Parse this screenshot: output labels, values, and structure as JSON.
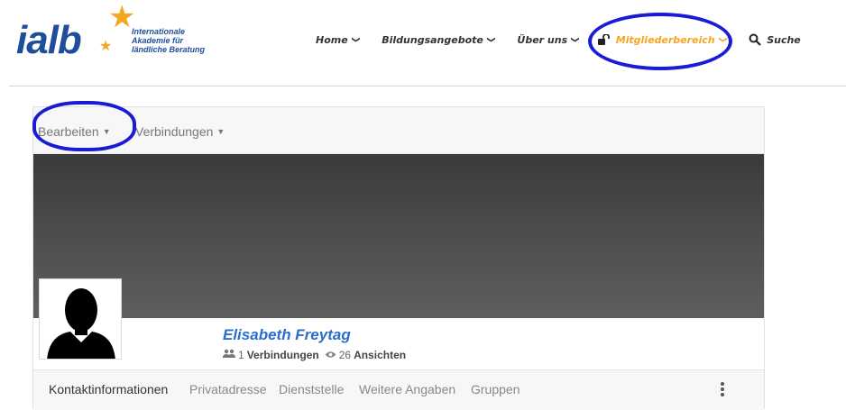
{
  "logo": {
    "word": "ialb",
    "text_lines": [
      "Internationale",
      "Akademie für",
      "ländliche Beratung"
    ]
  },
  "nav": {
    "items": [
      {
        "label": "Home",
        "has_dropdown": true
      },
      {
        "label": "Bildungsangebote",
        "has_dropdown": true
      },
      {
        "label": "Über uns",
        "has_dropdown": true
      },
      {
        "label": "Mitgliederbereich",
        "has_dropdown": true,
        "icon": "lock-open-icon",
        "color": "#f5a623"
      },
      {
        "label": "Suche",
        "icon": "search-icon"
      }
    ]
  },
  "toolbar": {
    "bearbeiten": "Bearbeiten",
    "verbindungen": "Verbindungen"
  },
  "profile": {
    "name": "Elisabeth Freytag",
    "connections_count": "1",
    "connections_label": "Verbindungen",
    "views_count": "26",
    "views_label": "Ansichten"
  },
  "tabs": [
    "Kontaktinformationen",
    "Privatadresse",
    "Dienststelle",
    "Weitere Angaben",
    "Gruppen"
  ],
  "colors": {
    "brand_blue": "#1e4d9c",
    "accent_orange": "#f5a623",
    "link_blue": "#2a6ecb",
    "annotation_blue": "#1b1bd6"
  }
}
